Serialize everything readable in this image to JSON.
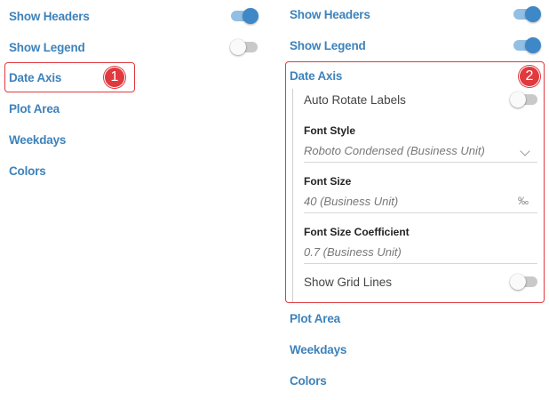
{
  "left": {
    "items": [
      {
        "label": "Show Headers",
        "toggle": true
      },
      {
        "label": "Show Legend",
        "toggle": false
      },
      {
        "label": "Date Axis"
      },
      {
        "label": "Plot Area"
      },
      {
        "label": "Weekdays"
      },
      {
        "label": "Colors"
      }
    ],
    "badge": "1"
  },
  "right": {
    "items": [
      {
        "label": "Show Headers",
        "toggle": true
      },
      {
        "label": "Show Legend",
        "toggle": true
      },
      {
        "label": "Date Axis"
      },
      {
        "label": "Plot Area"
      },
      {
        "label": "Weekdays"
      },
      {
        "label": "Colors"
      }
    ],
    "badge": "2",
    "date_axis": {
      "auto_rotate_label": "Auto Rotate Labels",
      "auto_rotate_value": false,
      "font_style_label": "Font Style",
      "font_style_value": "Roboto Condensed (Business Unit)",
      "font_size_label": "Font Size",
      "font_size_value": "40 (Business Unit)",
      "font_size_unit": "‰",
      "coeff_label": "Font Size Coefficient",
      "coeff_value": "0.7 (Business Unit)",
      "grid_lines_label": "Show Grid Lines",
      "grid_lines_value": false
    }
  },
  "colors": {
    "accent": "#3d82bb",
    "highlight": "#e0393e",
    "toggle_on": "#3f88c8"
  }
}
